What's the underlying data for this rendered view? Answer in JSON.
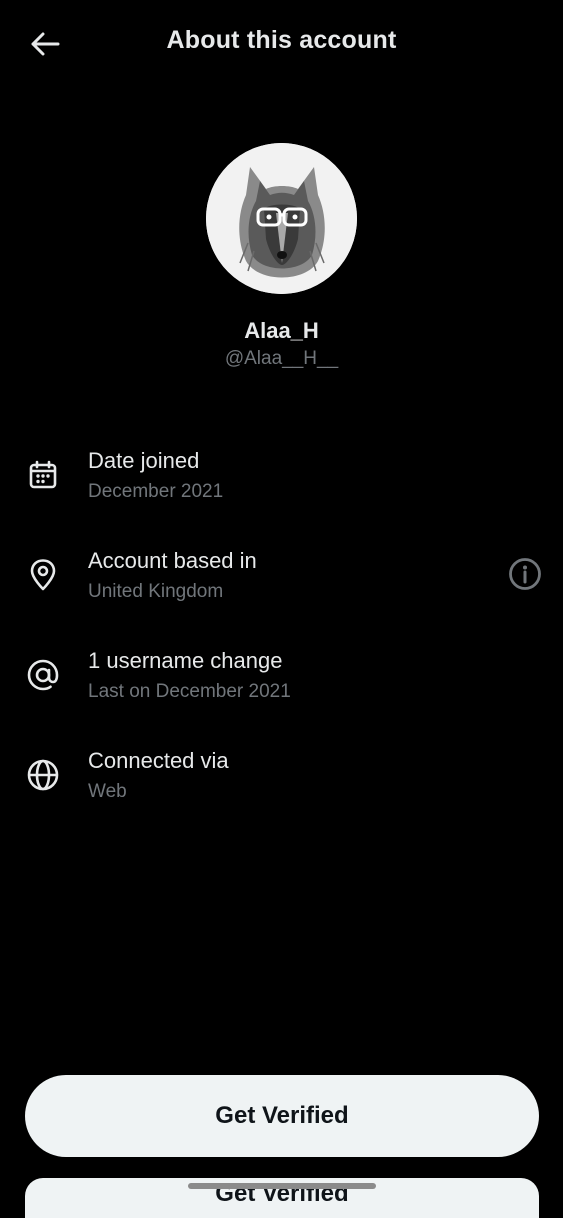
{
  "header": {
    "title": "About this account",
    "back_icon": "arrow-left-icon"
  },
  "profile": {
    "display_name": "Alaa_H",
    "handle": "@Alaa__H__",
    "avatar_icon": "wolf-with-glasses-avatar"
  },
  "details": [
    {
      "icon": "calendar-icon",
      "label": "Date joined",
      "value": "December 2021"
    },
    {
      "icon": "location-pin-icon",
      "label": "Account based in",
      "value": "United Kingdom",
      "trailing_icon": "info-circle-icon"
    },
    {
      "icon": "at-sign-icon",
      "label": "1 username change",
      "value": "Last on December 2021"
    },
    {
      "icon": "globe-icon",
      "label": "Connected via",
      "value": "Web"
    }
  ],
  "footer": {
    "cta_label": "Get Verified",
    "ghost_label": "Get Verified"
  },
  "colors": {
    "background": "#000000",
    "primary_text": "#e7e9ea",
    "secondary_text": "#71767b",
    "button_bg": "#eff3f4",
    "button_text": "#0f1419"
  }
}
